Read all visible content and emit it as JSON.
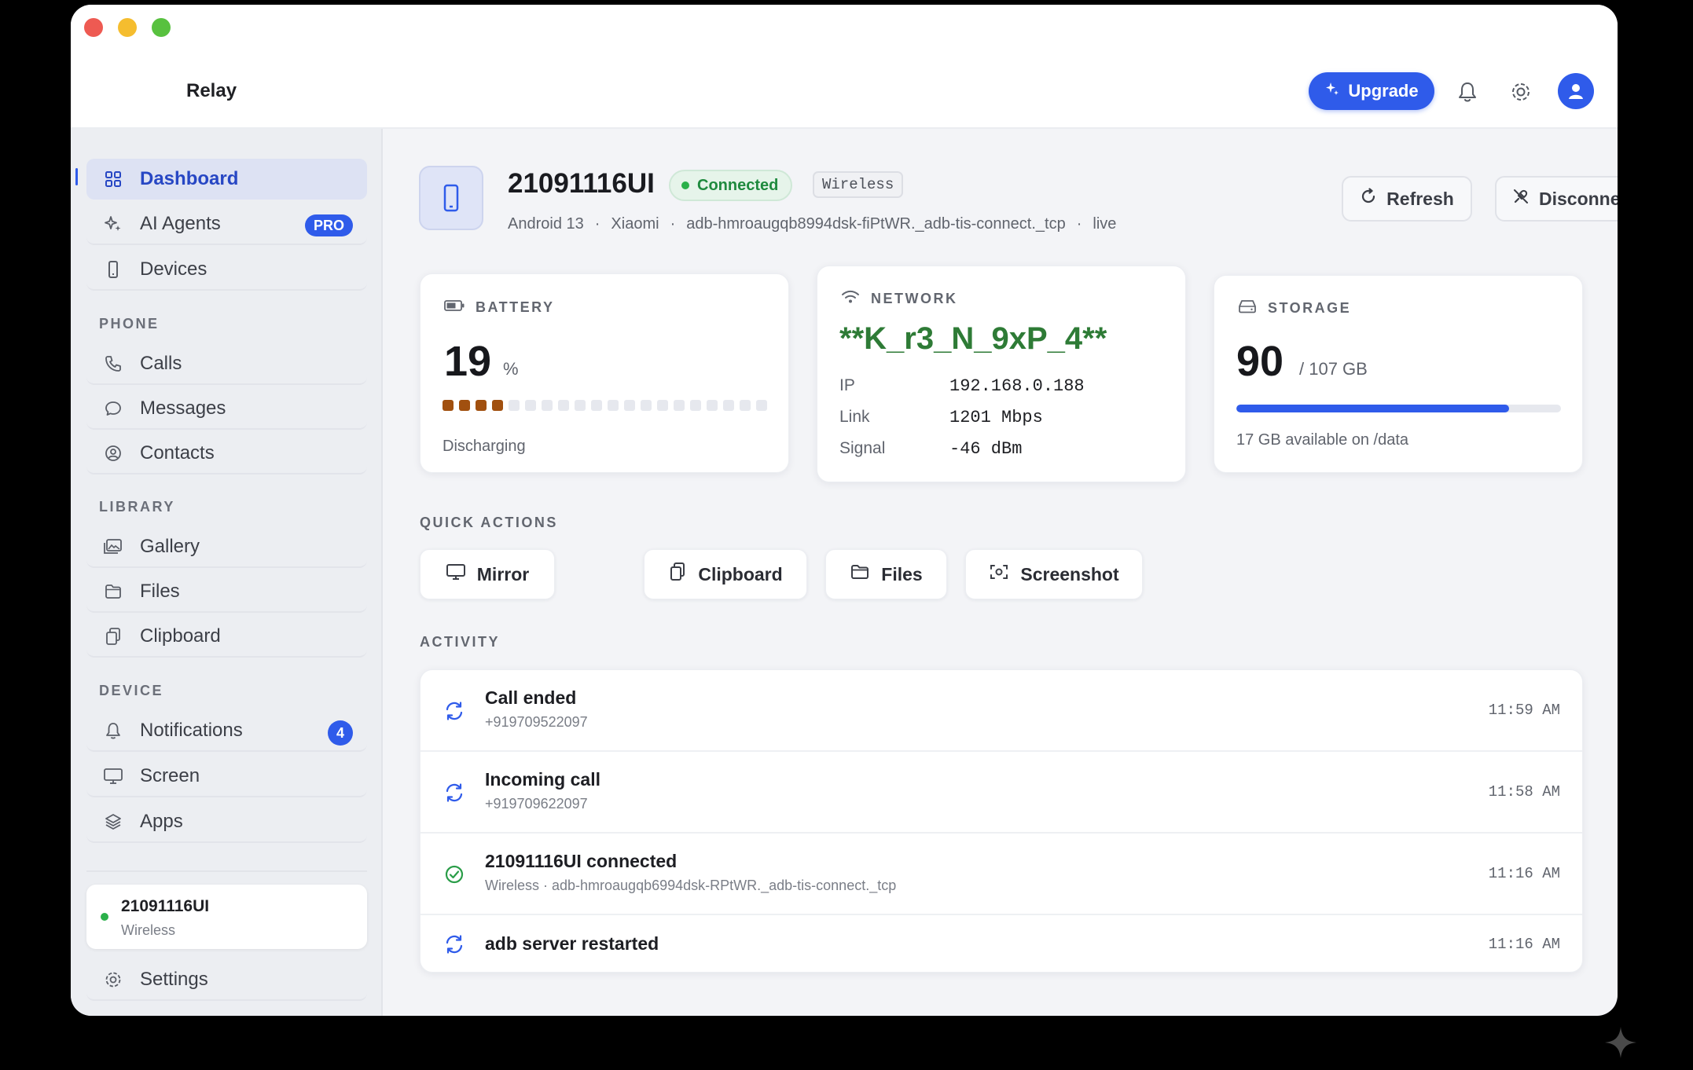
{
  "app": {
    "title": "Relay"
  },
  "header": {
    "upgrade_label": "Upgrade"
  },
  "sidebar": {
    "dashboard": "Dashboard",
    "ai_agents": "AI Agents",
    "ai_badge": "PRO",
    "devices": "Devices",
    "phone_section": "PHONE",
    "calls": "Calls",
    "messages": "Messages",
    "contacts": "Contacts",
    "library_section": "LIBRARY",
    "gallery": "Gallery",
    "files": "Files",
    "clipboard": "Clipboard",
    "device_section": "DEVICE",
    "notifications": "Notifications",
    "notifications_count": "4",
    "screen": "Screen",
    "apps": "Apps",
    "device_card": {
      "name": "21091116UI",
      "type": "Wireless"
    },
    "settings": "Settings"
  },
  "device": {
    "name": "21091116UI",
    "status": "Connected",
    "transport": "Wireless",
    "os": "Android 13",
    "maker": "Xiaomi",
    "serial": "adb-hmroaugqb8994dsk-fiPtWR._adb-tis-connect._tcp",
    "mode": "live",
    "sep": "·",
    "refresh_label": "Refresh",
    "disconnect_label": "Disconnect"
  },
  "battery": {
    "label": "BATTERY",
    "value": "19",
    "unit": "%",
    "level": 0.19,
    "status": "Discharging"
  },
  "network": {
    "label": "NETWORK",
    "ssid": "**K_r3_N_9xP_4**",
    "ip_label": "IP",
    "ip": "192.168.0.188",
    "link_label": "Link",
    "link": "1201 Mbps",
    "signal_label": "Signal",
    "signal": "-46 dBm"
  },
  "storage": {
    "label": "STORAGE",
    "value": "90",
    "total": "/ 107 GB",
    "fraction": 0.84,
    "available": "17 GB available on /data"
  },
  "quick_actions": {
    "label": "QUICK ACTIONS",
    "mirror": "Mirror",
    "clipboard": "Clipboard",
    "files": "Files",
    "screenshot": "Screenshot"
  },
  "activity": {
    "label": "ACTIVITY",
    "items": [
      {
        "title": "Call ended",
        "sub": "+919709522097",
        "time": "11:59 AM",
        "icon": "sync-icon"
      },
      {
        "title": "Incoming call",
        "sub": "+919709622097",
        "time": "11:58 AM",
        "icon": "sync-icon"
      },
      {
        "title": "21091116UI connected",
        "sub": "Wireless · adb-hmroaugqb6994dsk-RPtWR._adb-tis-connect._tcp",
        "time": "11:16 AM",
        "icon": "check-circle-icon"
      },
      {
        "title": "adb server restarted",
        "sub": "",
        "time": "11:16 AM",
        "icon": "sync-icon"
      }
    ]
  },
  "colors": {
    "accent": "#2f5bea",
    "connected": "#1f8a3e",
    "battery": "#a1500f",
    "ssid": "#2e7b36"
  }
}
